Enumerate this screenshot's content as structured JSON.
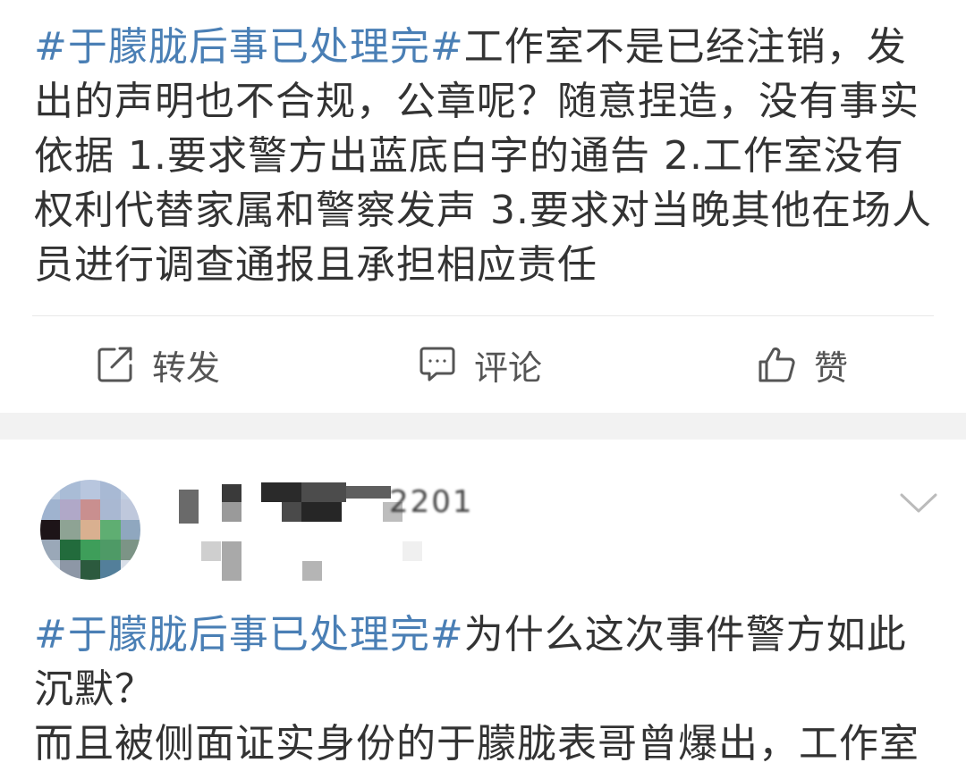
{
  "post1": {
    "hashtag": "#于朦胧后事已处理完#",
    "body": "工作室不是已经注销，发出的声明也不合规，公章呢？随意捏造，没有事实依据  1.要求警方出蓝底白字的通告 2.工作室没有权利代替家属和警察发声 3.要求对当晚其他在场人员进行调查通报且承担相应责任"
  },
  "actions": {
    "repost_label": "转发",
    "comment_label": "评论",
    "like_label": "赞",
    "icons": [
      "repost-icon",
      "comment-icon",
      "like-icon"
    ]
  },
  "post2": {
    "username_visible_fragment": "2201",
    "hashtag": "#于朦胧后事已处理完#",
    "body_line1": "为什么这次事件警方如此沉默？",
    "body_line2": "而且被侧面证实身份的于朦胧表哥曾爆出，工作室"
  },
  "colors": {
    "hashtag": "#4a7fb5",
    "text": "#333333",
    "action_text": "#555555",
    "separator_band": "#f2f2f2"
  }
}
